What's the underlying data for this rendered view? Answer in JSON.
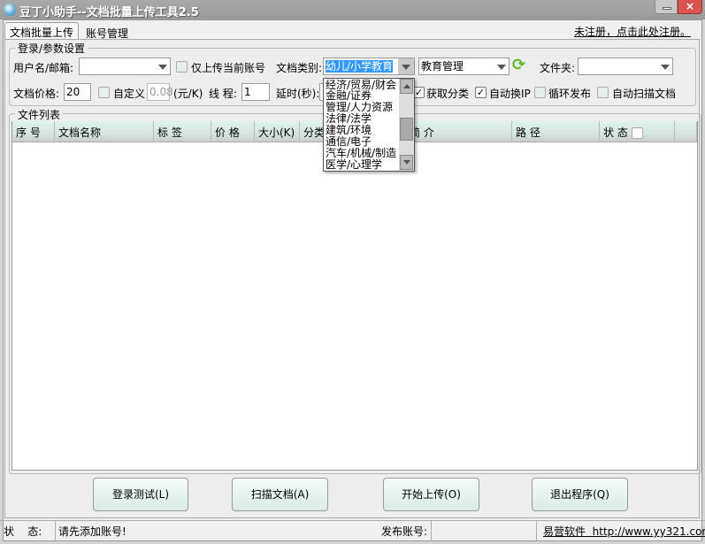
{
  "window": {
    "title": "豆丁小助手--文档批量上传工具2.5",
    "minimize": "minimize",
    "close": "×"
  },
  "tabs": [
    {
      "label": "文档批量上传",
      "active": true
    },
    {
      "label": "账号管理",
      "active": false
    }
  ],
  "register_link": "未注册，点击此处注册。",
  "settings": {
    "group_label": "登录/参数设置",
    "username_label": "用户名/邮箱:",
    "username_value": "",
    "only_current_label": "仅上传当前账号",
    "only_current_checked": false,
    "category_label": "文档类别:",
    "category_value": "幼儿/小学教育",
    "subcategory_value": "教育管理",
    "folder_label": "文件夹:",
    "folder_value": "",
    "price_label": "文档价格:",
    "price_value": "20",
    "custom_label": "自定义",
    "custom_checked": false,
    "custom_value": "0.08",
    "unit_label": "(元/K)",
    "threads_label": "线 程:",
    "threads_value": "1",
    "delay_label": "延时(秒):",
    "get_category_label": "获取分类",
    "get_category_checked": true,
    "auto_ip_label": "自动换IP",
    "auto_ip_checked": true,
    "loop_label": "循环发布",
    "loop_checked": false,
    "auto_scan_label": "自动扫描文档",
    "auto_scan_checked": false
  },
  "category_options": [
    "经济/贸易/财会",
    "金融/证券",
    "管理/人力资源",
    "法律/法学",
    "建筑/环境",
    "通信/电子",
    "汽车/机械/制造",
    "医学/心理学"
  ],
  "file_list": {
    "group_label": "文件列表",
    "columns": [
      "序  号",
      "文档名称",
      "标  签",
      "价  格",
      "大小(K)",
      "分类",
      "简  介",
      "路  径",
      "状  态"
    ],
    "rows": []
  },
  "buttons": {
    "login_test": "登录测试(L)",
    "scan": "扫描文档(A)",
    "start": "开始上传(O)",
    "exit": "退出程序(Q)"
  },
  "statusbar": {
    "status_label": "状    态:",
    "status_text": "请先添加账号!",
    "publish_label": "发布账号:",
    "publish_value": "",
    "company_link": "易营软件  http://www.yy321.com"
  },
  "colors": {
    "accent": "#3399ff",
    "header": "#dff1ea",
    "close": "#d9534f"
  }
}
